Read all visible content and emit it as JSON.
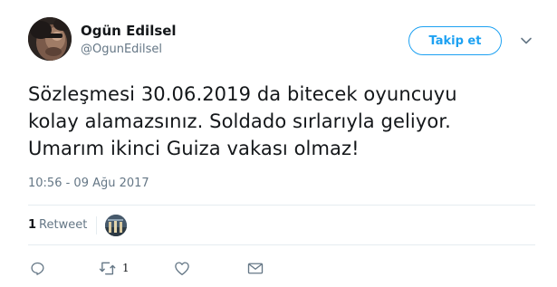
{
  "tweet": {
    "author": {
      "name": "Ogün Edilsel",
      "handle": "@OgunEdilsel"
    },
    "follow_label": "Takip et",
    "text_lines": [
      "Sözleşmesi 30.06.2019 da bitecek oyuncuyu",
      "kolay alamazsınız. Soldado sırlarıyla geliyor.",
      "Umarım ikinci Guiza vakası olmaz!"
    ],
    "timestamp": "10:56 - 09 Ağu 2017",
    "stats": {
      "retweet_count": "1",
      "retweet_label": "Retweet"
    },
    "actions": {
      "reply_icon": "reply-icon",
      "retweet_icon": "retweet-icon",
      "retweet_count": "1",
      "like_icon": "heart-icon",
      "message_icon": "envelope-icon"
    },
    "colors": {
      "accent": "#1da1f2",
      "secondary_text": "#657786",
      "primary_text": "#14171a",
      "divider": "#e6ecf0"
    }
  }
}
